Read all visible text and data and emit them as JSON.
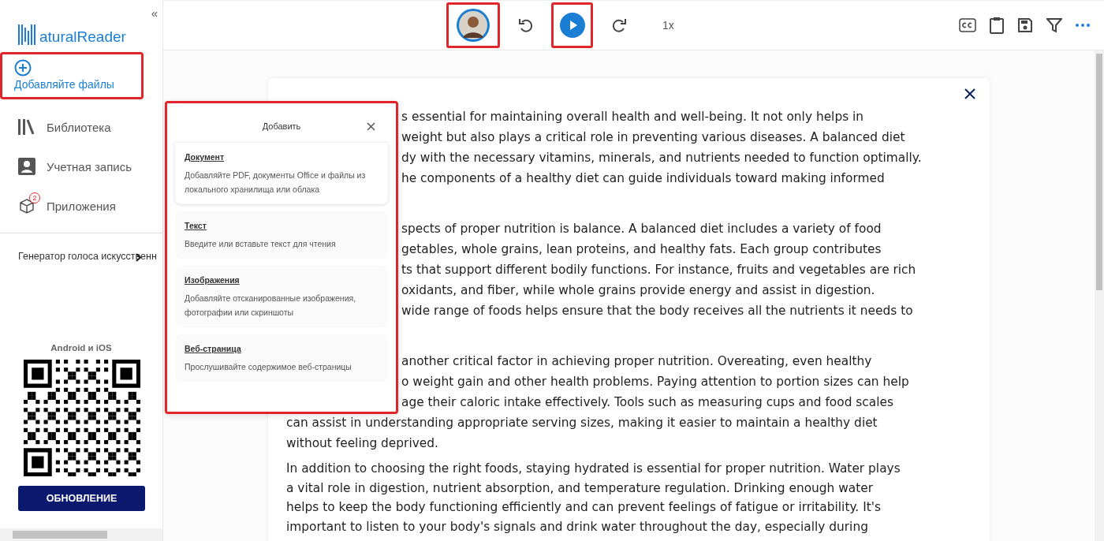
{
  "sidebar": {
    "logo": "aturalReader",
    "collapse": "«",
    "add_files": {
      "label": "Добавляйте файлы",
      "highlighted": true
    },
    "items": [
      {
        "kind": "library",
        "label": "Библиотека"
      },
      {
        "kind": "account",
        "label": "Учетная запись"
      },
      {
        "kind": "apps",
        "label": "Приложения",
        "badge": "2"
      }
    ],
    "generator": "Генератор голоса искусственн",
    "apps_caption": "Android и iOS",
    "update_button": "ОБНОВЛЕНИЕ"
  },
  "toolbar": {
    "voice_highlighted": true,
    "play_highlighted": true,
    "speed": "1x"
  },
  "popup": {
    "title": "Добавить",
    "highlighted": true,
    "options": [
      {
        "title": "Документ",
        "description": "Добавляйте PDF, документы Office и файлы из локального хранилища или облака",
        "selected": true
      },
      {
        "title": "Текст",
        "description": "Введите или вставьте текст для чтения",
        "selected": false
      },
      {
        "title": "Изображения",
        "description": "Добавляйте отсканированные изображения, фотографии или скриншоты",
        "selected": false
      },
      {
        "title": "Веб-страница",
        "description": "Прослушивайте содержимое веб-страницы",
        "selected": false
      }
    ]
  },
  "document": {
    "paragraphs": [
      {
        "ends_under_popup": true,
        "lines": [
          {
            "text": "s essential for maintaining overall health and well-being. It not only helps in",
            "covered": true
          },
          {
            "text": "weight but also plays a critical role in preventing various diseases. A balanced diet",
            "covered": true
          },
          {
            "text": "dy with the necessary vitamins, minerals, and nutrients needed to function optimally.",
            "covered": true
          },
          {
            "text": "he components of a healthy diet can guide individuals toward making informed",
            "covered": true
          }
        ]
      },
      {
        "ends_under_popup": true,
        "lines": [
          {
            "text": "spects of proper nutrition is balance. A balanced diet includes a variety of food",
            "covered": true
          },
          {
            "text": "getables, whole grains, lean proteins, and healthy fats. Each group contributes",
            "covered": true
          },
          {
            "text": "ts that support different bodily functions. For instance, fruits and vegetables are rich",
            "covered": true
          },
          {
            "text": "oxidants, and fiber, while whole grains provide energy and assist in digestion.",
            "covered": true
          },
          {
            "text": "wide range of foods helps ensure that the body receives all the nutrients it needs to",
            "covered": true
          }
        ]
      },
      {
        "ends_under_popup": false,
        "lines": [
          {
            "text": "another critical factor in achieving proper nutrition. Overeating, even healthy",
            "covered": true
          },
          {
            "text": "o weight gain and other health problems. Paying attention to portion sizes can help",
            "covered": true
          },
          {
            "text": "age their caloric intake effectively. Tools such as measuring cups and food scales",
            "covered": true
          },
          {
            "text": "can assist in understanding appropriate serving sizes, making it easier to maintain a healthy diet",
            "covered": false
          },
          {
            "text": "without feeling deprived.",
            "covered": false
          }
        ]
      },
      {
        "ends_under_popup": false,
        "lines": [
          {
            "text": "In addition to choosing the right foods, staying hydrated is essential for proper nutrition. Water plays",
            "covered": false
          },
          {
            "text": "a vital role in digestion, nutrient absorption, and temperature regulation. Drinking enough water",
            "covered": false
          },
          {
            "text": "helps to keep the body functioning efficiently and can prevent feelings of fatigue or irritability. It's",
            "covered": false
          },
          {
            "text": "important to listen to your body's signals and drink water throughout the day, especially during",
            "covered": false
          }
        ]
      }
    ]
  }
}
